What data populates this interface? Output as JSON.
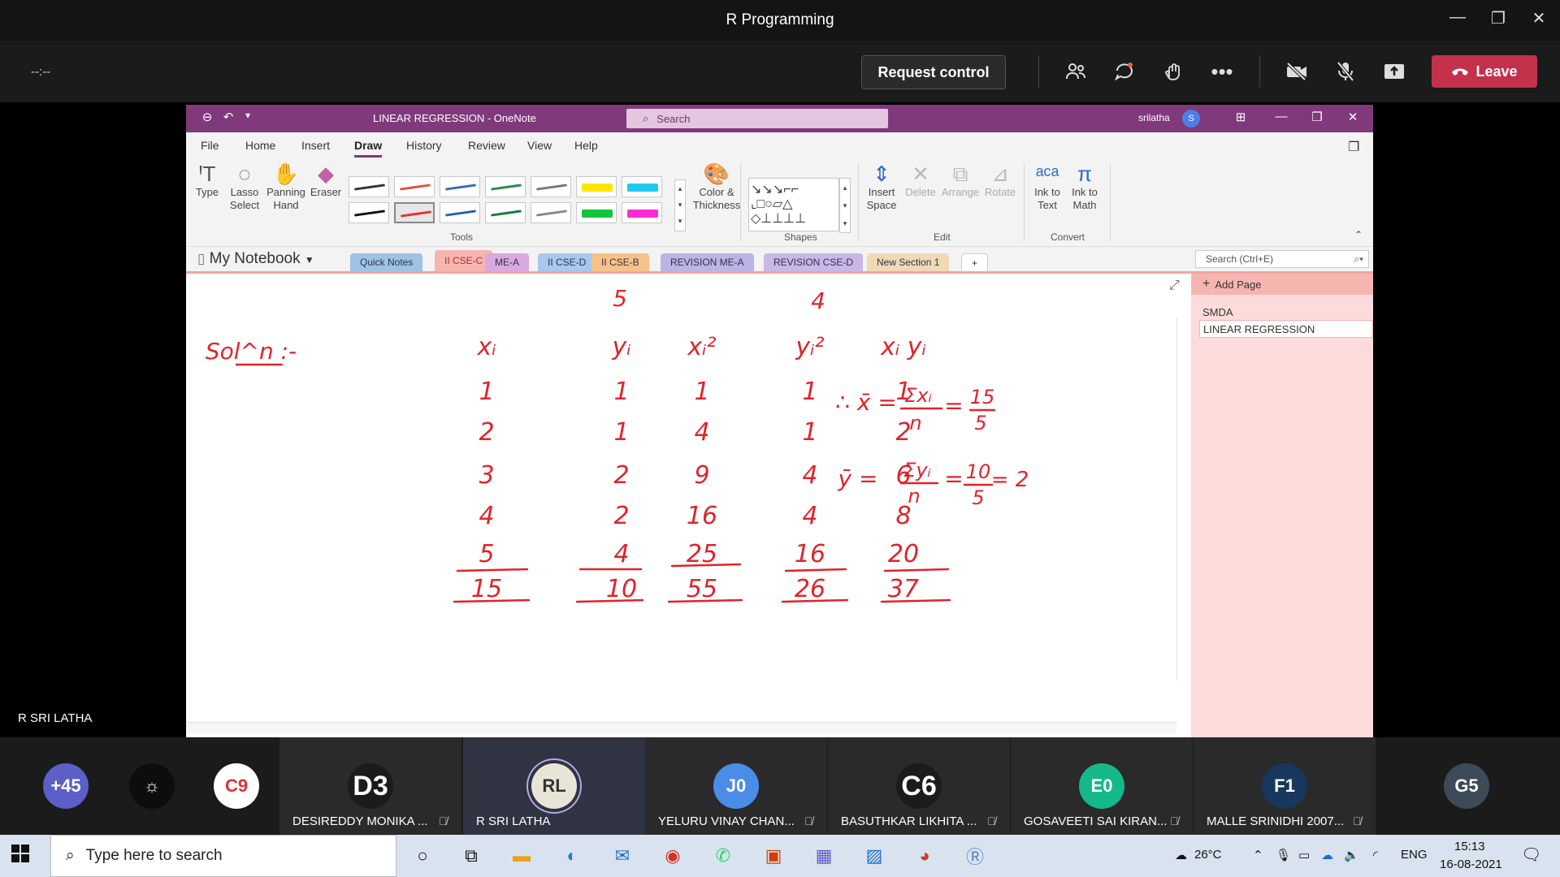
{
  "teams": {
    "window_title": "R Programming",
    "timer": "--:--",
    "request_control": "Request control",
    "leave": "Leave",
    "presenter_label": "R SRI LATHA"
  },
  "onenote": {
    "doc_title": "LINEAR REGRESSION - OneNote",
    "search_placeholder": "Search",
    "user": "srilatha",
    "user_initial": "S",
    "menu": [
      "File",
      "Home",
      "Insert",
      "Draw",
      "History",
      "Review",
      "View",
      "Help"
    ],
    "tools": {
      "type": "Type",
      "lasso": "Lasso Select",
      "panning": "Panning Hand",
      "eraser": "Eraser",
      "color_thickness": "Color & Thickness",
      "group_tools": "Tools",
      "group_shapes": "Shapes",
      "insert_space": "Insert Space",
      "delete": "Delete",
      "arrange": "Arrange",
      "rotate": "Rotate",
      "group_edit": "Edit",
      "ink_to_text": "Ink to Text",
      "ink_to_math": "Ink to Math",
      "group_convert": "Convert"
    },
    "pen_colors": [
      "#333333",
      "#d9534f",
      "#3a6bb3",
      "#2f8a4a",
      "#777777",
      "#ffe600",
      "#1ec8f0",
      "#111111",
      "#e03434",
      "#2a5fb0",
      "#217a3c",
      "#888888",
      "#12c43a",
      "#ff2ad4"
    ],
    "notebook": "My Notebook",
    "sections": [
      {
        "label": "Quick Notes",
        "color": "#9dc3e6"
      },
      {
        "label": "II CSE-C",
        "color": "#f7b5b0"
      },
      {
        "label": "ME-A",
        "color": "#d9a9e0"
      },
      {
        "label": "II CSE-D",
        "color": "#a8c8f0"
      },
      {
        "label": "II CSE-B",
        "color": "#f6c28b"
      },
      {
        "label": "REVISION ME-A",
        "color": "#bcb3e6"
      },
      {
        "label": "REVISION CSE-D",
        "color": "#c9b7e8"
      },
      {
        "label": "New Section 1",
        "color": "#f0d9b5"
      }
    ],
    "section_add": "+",
    "search_sections": "Search (Ctrl+E)",
    "add_page": "Add Page",
    "pages": [
      "SMDA",
      "LINEAR REGRESSION"
    ]
  },
  "ink": {
    "top_values": [
      "5",
      "4"
    ],
    "label": "Sol^n :-",
    "headers": [
      "x_i",
      "y_i",
      "x_i^2",
      "y_i^2",
      "x_i y_i"
    ],
    "rows": [
      [
        "1",
        "1",
        "1",
        "1",
        "1"
      ],
      [
        "2",
        "1",
        "4",
        "1",
        "2"
      ],
      [
        "3",
        "2",
        "9",
        "4",
        "6"
      ],
      [
        "4",
        "2",
        "16",
        "4",
        "8"
      ],
      [
        "5",
        "4",
        "25",
        "16",
        "20"
      ]
    ],
    "totals": [
      "15",
      "10",
      "55",
      "26",
      "37"
    ],
    "xbar_eq": [
      "∴ x̄ =",
      "Σxᵢ",
      "n",
      "=",
      "15",
      "5"
    ],
    "ybar_eq": [
      "ȳ =",
      "Σyᵢ",
      "n",
      "=",
      "10",
      "5",
      "= 2"
    ],
    "color": "#e0242b"
  },
  "participants": [
    {
      "initials": "+45",
      "name": "",
      "bg": "#5b5fc7",
      "mic": false
    },
    {
      "initials": "☼",
      "name": "",
      "bg": "#0d0d0d",
      "mic": false
    },
    {
      "initials": "C9",
      "name": "",
      "bg": "#ffffff",
      "mic": false
    },
    {
      "initials": "D3",
      "name": "DESIREDDY MONIKA ...",
      "bg": "#1b1b1b",
      "mic": true
    },
    {
      "initials": "RL",
      "name": "R SRI LATHA",
      "bg": "#e8e4d7",
      "mic": false
    },
    {
      "initials": "J0",
      "name": "YELURU VINAY CHAN...",
      "bg": "#4a8de8",
      "mic": true
    },
    {
      "initials": "C6",
      "name": "BASUTHKAR LIKHITA ...",
      "bg": "#1b1b1b",
      "mic": true
    },
    {
      "initials": "E0",
      "name": "GOSAVEETI SAI KIRAN...",
      "bg": "#13b98b",
      "mic": true
    },
    {
      "initials": "F1",
      "name": "MALLE SRINIDHI 2007...",
      "bg": "#17375c",
      "mic": true
    },
    {
      "initials": "G5",
      "name": "",
      "bg": "#3d4a57",
      "mic": false
    }
  ],
  "taskbar": {
    "search_placeholder": "Type here to search",
    "weather": "26°C",
    "lang": "ENG",
    "time": "15:13",
    "date": "16-08-2021"
  }
}
